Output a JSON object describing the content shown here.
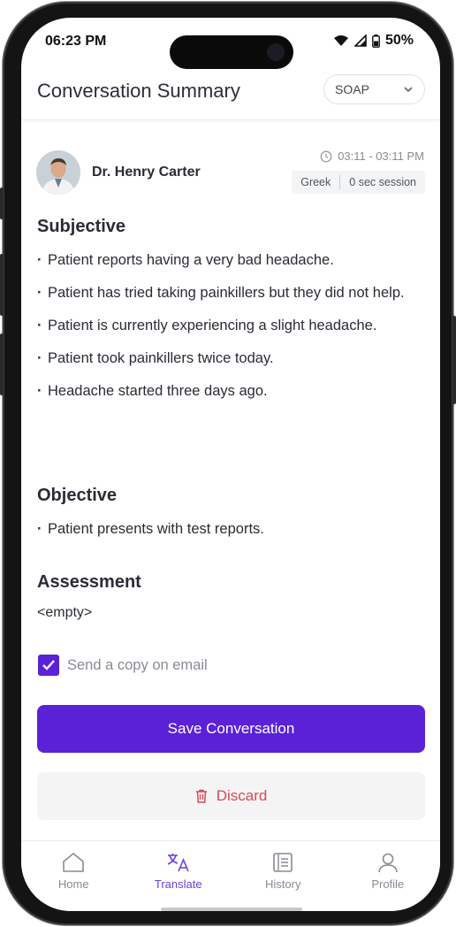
{
  "status_bar": {
    "time": "06:23 PM",
    "battery": "50%"
  },
  "header": {
    "title": "Conversation Summary",
    "format_select": {
      "selected": "SOAP"
    }
  },
  "doctor": {
    "name": "Dr. Henry Carter"
  },
  "session": {
    "time_range": "03:11 - 03:11 PM",
    "language": "Greek",
    "duration": "0 sec session"
  },
  "sections": {
    "subjective": {
      "title": "Subjective",
      "items": [
        "Patient reports having a very bad headache.",
        "Patient has tried taking painkillers but they did not help.",
        "Patient is currently experiencing a slight headache.",
        "Patient took painkillers twice today.",
        "Headache started three days ago."
      ]
    },
    "objective": {
      "title": "Objective",
      "items": [
        "Patient presents with test reports."
      ]
    },
    "assessment": {
      "title": "Assessment",
      "value": "<empty>"
    }
  },
  "email_copy": {
    "label": "Send a copy on email",
    "checked": true
  },
  "actions": {
    "save_label": "Save Conversation",
    "discard_label": "Discard"
  },
  "tabs": [
    {
      "label": "Home",
      "icon": "home-icon",
      "active": false
    },
    {
      "label": "Translate",
      "icon": "translate-icon",
      "active": true
    },
    {
      "label": "History",
      "icon": "history-icon",
      "active": false
    },
    {
      "label": "Profile",
      "icon": "profile-icon",
      "active": false
    }
  ],
  "colors": {
    "accent": "#5b21d6",
    "danger": "#d64b55",
    "active_tab": "#6b3fd9"
  }
}
